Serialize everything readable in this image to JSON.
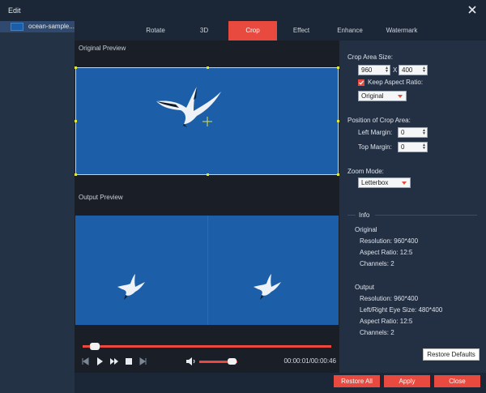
{
  "window": {
    "title": "Edit"
  },
  "sidebar": {
    "items": [
      {
        "name": "ocean-sample..."
      }
    ]
  },
  "tabs": [
    {
      "label": "Rotate",
      "active": false
    },
    {
      "label": "3D",
      "active": false
    },
    {
      "label": "Crop",
      "active": true
    },
    {
      "label": "Effect",
      "active": false
    },
    {
      "label": "Enhance",
      "active": false
    },
    {
      "label": "Watermark",
      "active": false
    }
  ],
  "preview": {
    "original_label": "Original Preview",
    "output_label": "Output Preview"
  },
  "player": {
    "progress": 0.05,
    "volume": 0.8,
    "time": "00:00:01/00:00:46"
  },
  "crop": {
    "area_size_label": "Crop Area Size:",
    "width": "960",
    "height": "400",
    "times_symbol": "X",
    "keep_aspect_label": "Keep Aspect Ratio:",
    "keep_aspect_checked": true,
    "aspect_mode": "Original",
    "position_label": "Position of Crop Area:",
    "left_margin_label": "Left Margin:",
    "left_margin": "0",
    "top_margin_label": "Top Margin:",
    "top_margin": "0",
    "zoom_mode_label": "Zoom Mode:",
    "zoom_mode": "Letterbox"
  },
  "info": {
    "heading": "Info",
    "original_heading": "Original",
    "original_resolution": "Resolution: 960*400",
    "original_aspect": "Aspect Ratio: 12:5",
    "original_channels": "Channels: 2",
    "output_heading": "Output",
    "output_resolution": "Resolution: 960*400",
    "output_eye_size": "Left/Right Eye Size: 480*400",
    "output_aspect": "Aspect Ratio: 12:5",
    "output_channels": "Channels: 2"
  },
  "buttons": {
    "restore_defaults": "Restore Defaults",
    "restore_all": "Restore All",
    "apply": "Apply",
    "close": "Close"
  },
  "colors": {
    "accent": "#e94a3f",
    "crop_frame": "#d9e54a",
    "preview_bg": "#1d5ea8"
  }
}
